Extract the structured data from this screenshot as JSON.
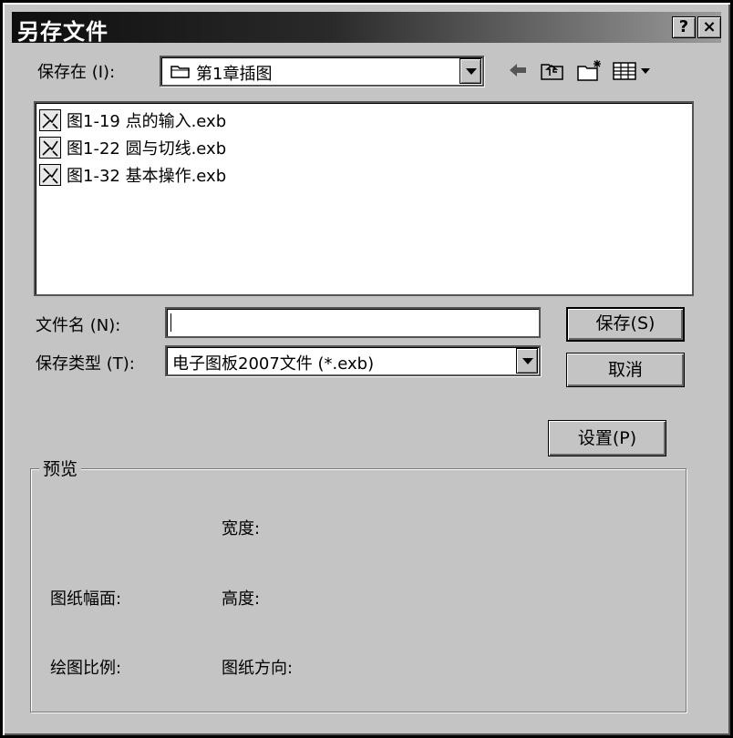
{
  "window": {
    "title": "另存文件",
    "help_label": "?",
    "close_label": "×"
  },
  "save_in": {
    "label": "保存在 (I):",
    "folder": "第1章插图"
  },
  "toolbar": {
    "icons": [
      "back-arrow-icon",
      "up-folder-icon",
      "new-folder-icon",
      "view-menu-icon"
    ]
  },
  "files": [
    {
      "name": "图1-19 点的输入.exb"
    },
    {
      "name": "图1-22 圆与切线.exb"
    },
    {
      "name": "图1-32 基本操作.exb"
    }
  ],
  "filename": {
    "label": "文件名 (N):",
    "value": ""
  },
  "filetype": {
    "label": "保存类型 (T):",
    "value": "电子图板2007文件 (*.exb)"
  },
  "buttons": {
    "save": "保存(S)",
    "cancel": "取消",
    "settings": "设置(P)"
  },
  "preview": {
    "title": "预览",
    "width_label": "宽度:",
    "paper_size_label": "图纸幅面:",
    "height_label": "高度:",
    "scale_label": "绘图比例:",
    "orientation_label": "图纸方向:"
  }
}
